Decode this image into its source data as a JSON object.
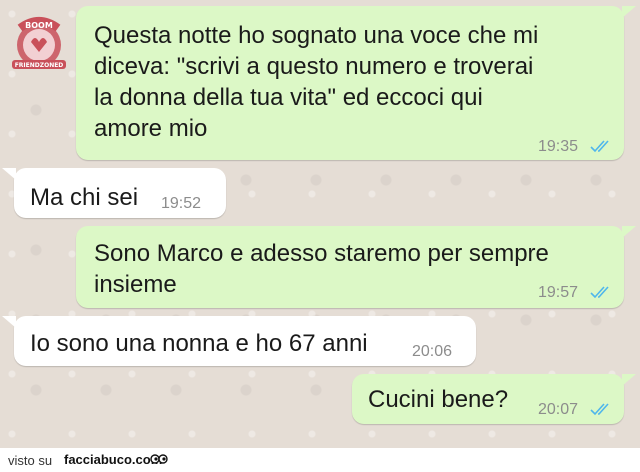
{
  "logo": {
    "top_text": "BOOM",
    "bottom_text": "FRIENDZONED"
  },
  "messages": [
    {
      "direction": "outgoing",
      "lines": [
        "Questa notte ho sognato una voce che mi",
        "diceva: \"scrivi a questo  numero e troverai",
        "la donna della tua vita\" ed eccoci qui",
        "amore mio"
      ],
      "time": "19:35",
      "status": "read"
    },
    {
      "direction": "incoming",
      "lines": [
        "Ma chi sei"
      ],
      "time": "19:52"
    },
    {
      "direction": "outgoing",
      "lines": [
        "Sono Marco e adesso staremo per sempre",
        "insieme"
      ],
      "time": "19:57",
      "status": "read"
    },
    {
      "direction": "incoming",
      "lines": [
        "Io sono una nonna e ho 67 anni"
      ],
      "time": "20:06"
    },
    {
      "direction": "outgoing",
      "lines": [
        "Cucini bene?"
      ],
      "time": "20:07",
      "status": "read"
    }
  ],
  "footer": {
    "seen_label": "visto su",
    "site": "facciabuco.com"
  },
  "colors": {
    "outgoing_bubble": "#dcf8c6",
    "incoming_bubble": "#ffffff",
    "read_ticks": "#4fb6ec",
    "background": "#e5ddd5"
  }
}
